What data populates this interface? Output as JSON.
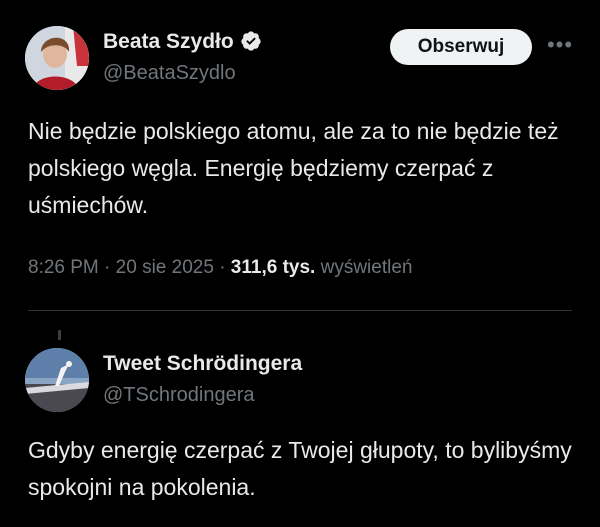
{
  "tweet1": {
    "name": "Beata Szydło",
    "handle": "@BeataSzydlo",
    "follow_label": "Obserwuj",
    "more_label": "•••",
    "text": "Nie będzie polskiego atomu, ale za to nie będzie też polskiego węgla. Energię będziemy czerpać z uśmiechów.",
    "time": "8:26 PM",
    "sep1": "·",
    "date": "20 sie 2025",
    "sep2": "·",
    "views": "311,6 tys.",
    "views_label": "wyświetleń",
    "verified_color": "#e7e9ea"
  },
  "tweet2": {
    "name": "Tweet Schrödingera",
    "handle": "@TSchrodingera",
    "text": "Gdyby energię czerpać z Twojej głupoty, to bylibyśmy spokojni na pokolenia."
  },
  "colors": {
    "background": "#000000",
    "text": "#e7e9ea",
    "secondary": "#71767b",
    "button_bg": "#eff3f4",
    "divider": "#2f3336"
  }
}
